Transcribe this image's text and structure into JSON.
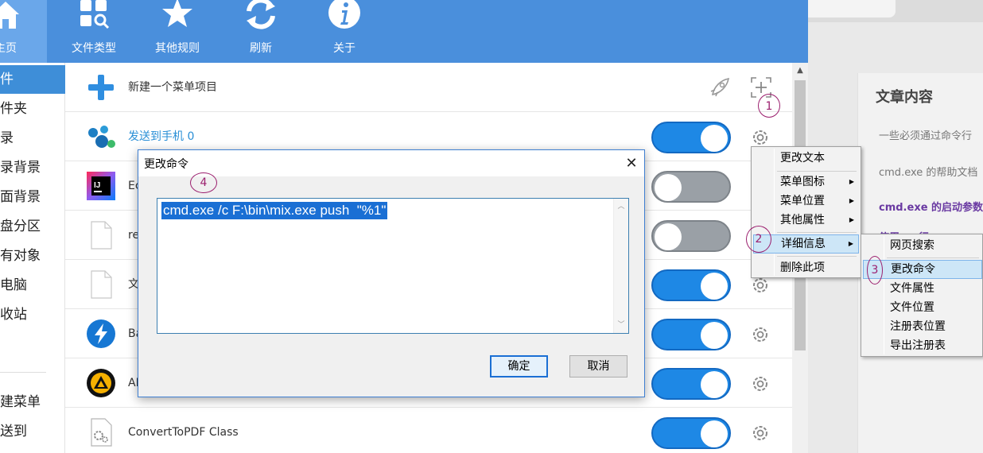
{
  "toolbar": {
    "buttons": [
      {
        "label": "主页",
        "icon": "home-icon"
      },
      {
        "label": "文件类型",
        "icon": "file-types-icon"
      },
      {
        "label": "其他规则",
        "icon": "star-icon"
      },
      {
        "label": "刷新",
        "icon": "refresh-icon"
      },
      {
        "label": "关于",
        "icon": "info-icon"
      }
    ]
  },
  "sidebar": {
    "items": [
      {
        "label": "件"
      },
      {
        "label": "件夹"
      },
      {
        "label": "录"
      },
      {
        "label": "录背景"
      },
      {
        "label": "面背景"
      },
      {
        "label": "盘分区"
      },
      {
        "label": "有对象"
      },
      {
        "label": "电脑"
      },
      {
        "label": "收站"
      },
      {
        "label": "建菜单"
      },
      {
        "label": "送到"
      }
    ]
  },
  "list": {
    "add_row": {
      "label": "新建一个菜单项目"
    },
    "rows": [
      {
        "label": "发送到手机 0",
        "icon": "network-icon",
        "enabled": true
      },
      {
        "label": "Ec",
        "icon": "intellij-icon",
        "enabled": false
      },
      {
        "label": "re",
        "icon": "blank-file-icon",
        "enabled": false
      },
      {
        "label": "文",
        "icon": "blank-file-icon",
        "enabled": true
      },
      {
        "label": "Ba",
        "icon": "lightning-icon",
        "enabled": true
      },
      {
        "label": "AI",
        "icon": "aimp-icon",
        "enabled": true
      },
      {
        "label": "ConvertToPDF Class",
        "icon": "gear-file-icon",
        "enabled": true
      }
    ]
  },
  "dialog": {
    "title": "更改命令",
    "command": "cmd.exe /c F:\\bin\\mix.exe push  \"%1\"",
    "ok_label": "确定",
    "cancel_label": "取消"
  },
  "context_menu": {
    "items": [
      "更改文本",
      "菜单图标",
      "菜单位置",
      "其他属性",
      "详细信息",
      "删除此项"
    ]
  },
  "submenu": {
    "items": [
      "网页搜索",
      "更改命令",
      "文件属性",
      "文件位置",
      "注册表位置",
      "导出注册表"
    ]
  },
  "annotations": [
    "1",
    "2",
    "3",
    "4"
  ],
  "background_page": {
    "title": "文章内容",
    "line1": "一些必须通过命令行",
    "line2": "cmd.exe 的帮助文档",
    "line3": "cmd.exe 的启动参数",
    "line4": "使用   ...  行"
  },
  "colors": {
    "toolbar_bg": "#4a8fdc",
    "toggle_on": "#1e88e5",
    "toggle_off": "#9aa0a6",
    "selection": "#1a6fd4",
    "annotation": "#9b1f6e"
  }
}
